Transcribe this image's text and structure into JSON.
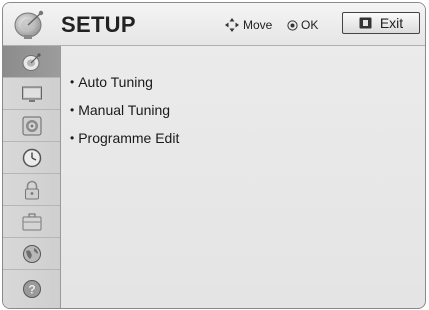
{
  "header": {
    "title": "SETUP",
    "move_hint": "Move",
    "ok_hint": "OK",
    "exit_label": "Exit"
  },
  "sidebar": {
    "items": [
      {
        "icon": "satellite-dish-icon",
        "selected": true
      },
      {
        "icon": "tv-picture-icon",
        "selected": false
      },
      {
        "icon": "speaker-audio-icon",
        "selected": false
      },
      {
        "icon": "clock-time-icon",
        "selected": false
      },
      {
        "icon": "lock-icon",
        "selected": false
      },
      {
        "icon": "briefcase-option-icon",
        "selected": false
      },
      {
        "icon": "globe-network-icon",
        "selected": false
      },
      {
        "icon": "question-help-icon",
        "selected": false
      }
    ]
  },
  "menu": {
    "bullet": "•",
    "items": [
      {
        "label": "Auto Tuning"
      },
      {
        "label": "Manual Tuning"
      },
      {
        "label": "Programme Edit"
      }
    ]
  },
  "colors": {
    "background": "#e6e6e6",
    "sidebar_selected": "#939393",
    "text": "#1a1a1a"
  }
}
